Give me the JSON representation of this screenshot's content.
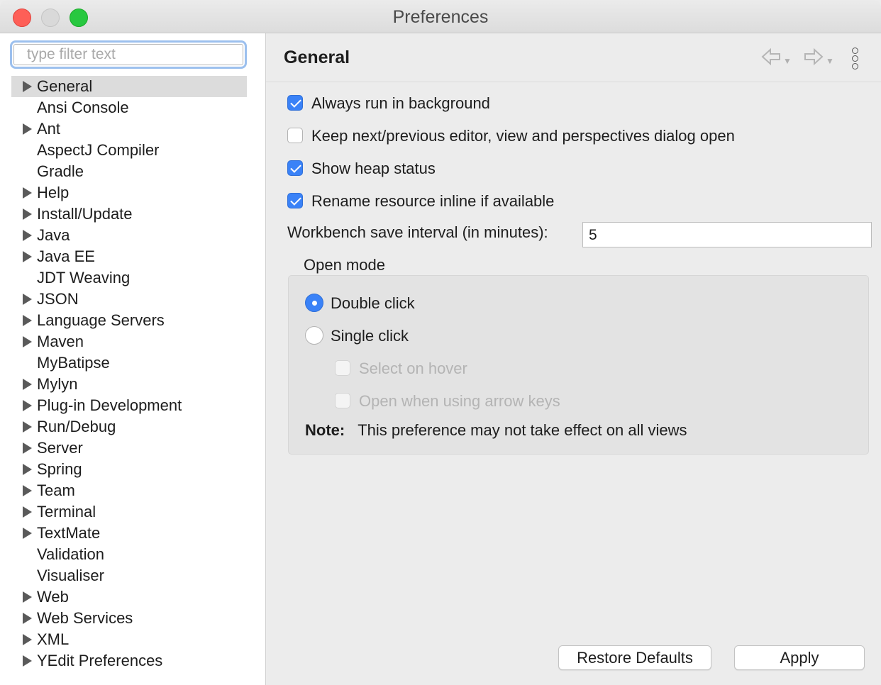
{
  "window": {
    "title": "Preferences"
  },
  "sidebar": {
    "filter_placeholder": "type filter text",
    "items": [
      {
        "label": "General",
        "expandable": true,
        "selected": true
      },
      {
        "label": "Ansi Console",
        "expandable": false
      },
      {
        "label": "Ant",
        "expandable": true
      },
      {
        "label": "AspectJ Compiler",
        "expandable": false
      },
      {
        "label": "Gradle",
        "expandable": false
      },
      {
        "label": "Help",
        "expandable": true
      },
      {
        "label": "Install/Update",
        "expandable": true
      },
      {
        "label": "Java",
        "expandable": true
      },
      {
        "label": "Java EE",
        "expandable": true
      },
      {
        "label": "JDT Weaving",
        "expandable": false
      },
      {
        "label": "JSON",
        "expandable": true
      },
      {
        "label": "Language Servers",
        "expandable": true
      },
      {
        "label": "Maven",
        "expandable": true
      },
      {
        "label": "MyBatipse",
        "expandable": false
      },
      {
        "label": "Mylyn",
        "expandable": true
      },
      {
        "label": "Plug-in Development",
        "expandable": true
      },
      {
        "label": "Run/Debug",
        "expandable": true
      },
      {
        "label": "Server",
        "expandable": true
      },
      {
        "label": "Spring",
        "expandable": true
      },
      {
        "label": "Team",
        "expandable": true
      },
      {
        "label": "Terminal",
        "expandable": true
      },
      {
        "label": "TextMate",
        "expandable": true
      },
      {
        "label": "Validation",
        "expandable": false
      },
      {
        "label": "Visualiser",
        "expandable": false
      },
      {
        "label": "Web",
        "expandable": true
      },
      {
        "label": "Web Services",
        "expandable": true
      },
      {
        "label": "XML",
        "expandable": true
      },
      {
        "label": "YEdit Preferences",
        "expandable": true
      }
    ]
  },
  "main": {
    "title": "General",
    "options": {
      "always_run_background": {
        "label": "Always run in background",
        "checked": true
      },
      "keep_dialog_open": {
        "label": "Keep next/previous editor, view and perspectives dialog open",
        "checked": false
      },
      "show_heap_status": {
        "label": "Show heap status",
        "checked": true
      },
      "rename_inline": {
        "label": "Rename resource inline if available",
        "checked": true
      }
    },
    "save_interval": {
      "label": "Workbench save interval (in minutes):",
      "value": "5"
    },
    "open_mode": {
      "label": "Open mode",
      "double_click": "Double click",
      "single_click": "Single click",
      "selected": "Double click",
      "select_on_hover": "Select on hover",
      "open_arrow_keys": "Open when using arrow keys",
      "note_label": "Note:",
      "note_text": "This preference may not take effect on all views"
    },
    "buttons": {
      "restore_defaults": "Restore Defaults",
      "apply": "Apply"
    }
  },
  "colors": {
    "accent": "#3a82f7",
    "selection": "#dcdcdc",
    "close": "#fe5f57",
    "maximize": "#28c840"
  },
  "icons": {
    "back": "back-arrow-icon",
    "forward": "forward-arrow-icon",
    "menu": "view-menu-icon",
    "expand": "expand-triangle-icon"
  }
}
